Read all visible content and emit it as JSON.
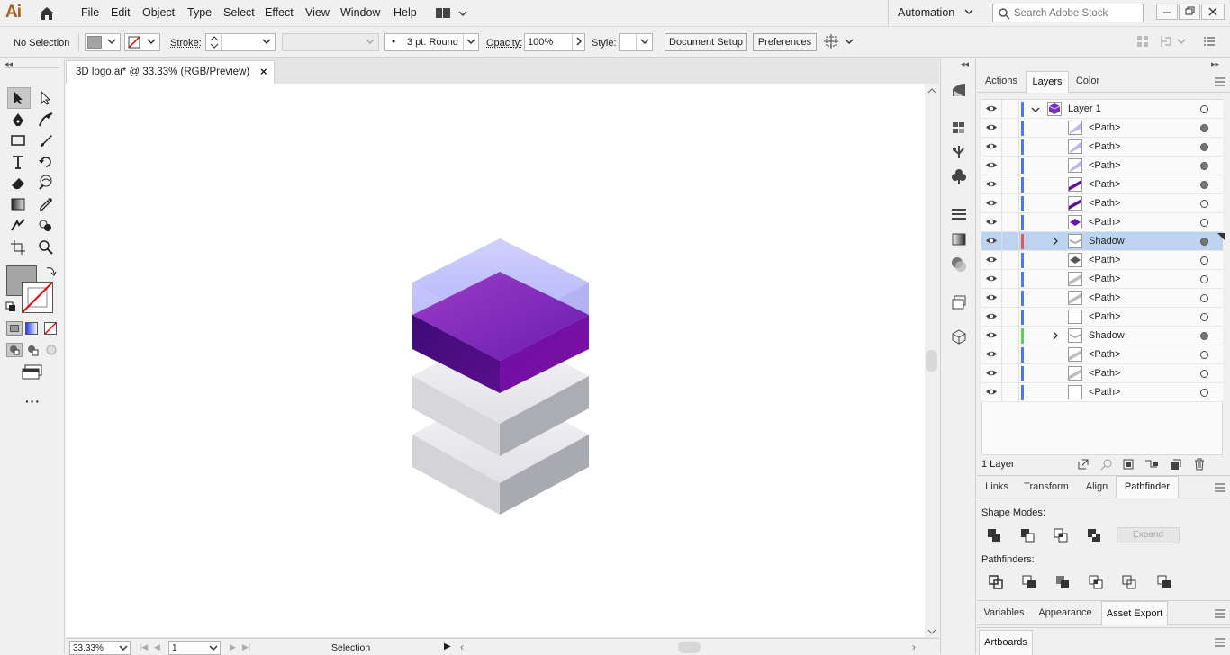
{
  "app": {
    "logo": "Ai",
    "automation": "Automation",
    "search_placeholder": "Search Adobe Stock"
  },
  "menu": [
    "File",
    "Edit",
    "Object",
    "Type",
    "Select",
    "Effect",
    "View",
    "Window",
    "Help"
  ],
  "control": {
    "selection": "No Selection",
    "stroke_label": "Stroke:",
    "brush": "3 pt. Round",
    "opacity_label": "Opacity:",
    "opacity_value": "100%",
    "style_label": "Style:",
    "doc_setup": "Document Setup",
    "preferences": "Preferences"
  },
  "document": {
    "tab_title": "3D logo.ai* @ 33.33% (RGB/Preview)",
    "close": "×"
  },
  "status": {
    "zoom": "33.33%",
    "artboard": "1",
    "tool": "Selection"
  },
  "panel_tabs": {
    "actions": "Actions",
    "layers": "Layers",
    "color": "Color"
  },
  "layers": [
    {
      "name": "Layer 1",
      "color": "#4b7be8",
      "target": "empty"
    },
    {
      "name": "<Path>",
      "color": "#4b7be8",
      "target": "filled"
    },
    {
      "name": "<Path>",
      "color": "#4b7be8",
      "target": "filled"
    },
    {
      "name": "<Path>",
      "color": "#4b7be8",
      "target": "filled"
    },
    {
      "name": "<Path>",
      "color": "#4b7be8",
      "target": "filled"
    },
    {
      "name": "<Path>",
      "color": "#4b7be8",
      "target": "empty"
    },
    {
      "name": "<Path>",
      "color": "#4b7be8",
      "target": "empty"
    },
    {
      "name": "Shadow",
      "color": "#e05a5a",
      "target": "filled"
    },
    {
      "name": "<Path>",
      "color": "#4b7be8",
      "target": "empty"
    },
    {
      "name": "<Path>",
      "color": "#4b7be8",
      "target": "empty"
    },
    {
      "name": "<Path>",
      "color": "#4b7be8",
      "target": "empty"
    },
    {
      "name": "<Path>",
      "color": "#4b7be8",
      "target": "empty"
    },
    {
      "name": "Shadow",
      "color": "#5ad25a",
      "target": "filled"
    },
    {
      "name": "<Path>",
      "color": "#4b7be8",
      "target": "empty"
    },
    {
      "name": "<Path>",
      "color": "#4b7be8",
      "target": "empty"
    },
    {
      "name": "<Path>",
      "color": "#4b7be8",
      "target": "empty"
    }
  ],
  "layers_footer": "1 Layer",
  "panel2_tabs": {
    "links": "Links",
    "transform": "Transform",
    "align": "Align",
    "pathfinder": "Pathfinder"
  },
  "pathfinder": {
    "shape_modes": "Shape Modes:",
    "expand": "Expand",
    "pathfinders": "Pathfinders:"
  },
  "panel3_tabs": {
    "variables": "Variables",
    "appearance": "Appearance",
    "asset_export": "Asset Export"
  },
  "artboards_tab": "Artboards"
}
